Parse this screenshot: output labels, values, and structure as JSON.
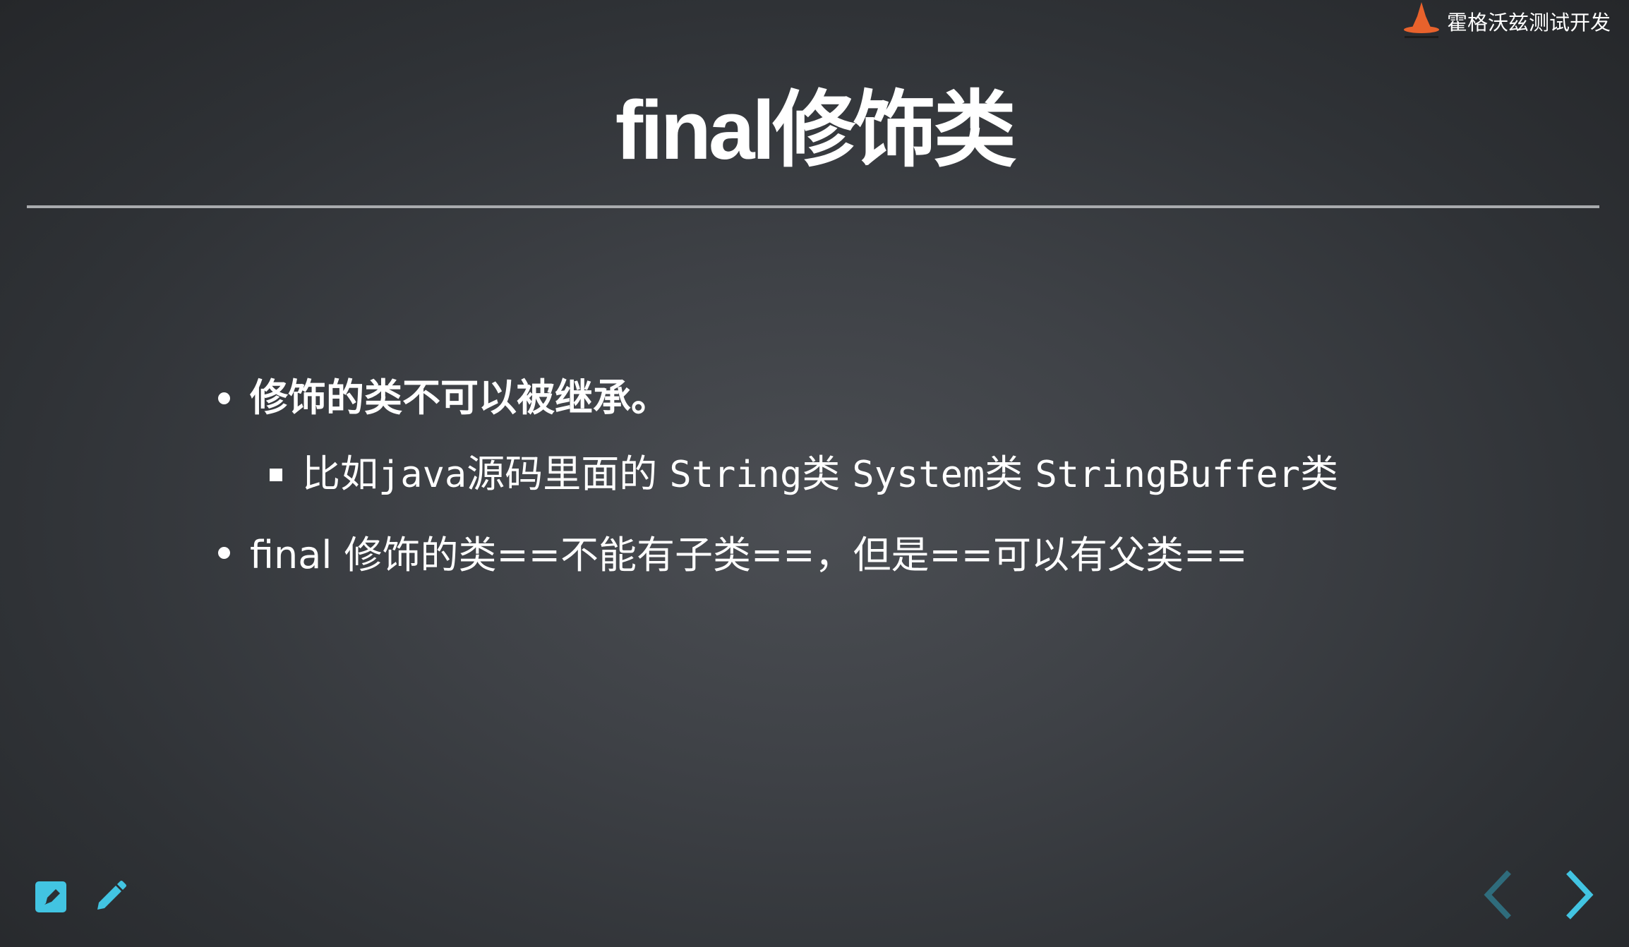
{
  "brand": {
    "name": "霍格沃兹测试开发",
    "logo_icon": "wizard-hat-icon",
    "logo_color": "#e8622c"
  },
  "slide": {
    "title": "final修饰类",
    "bullets": [
      {
        "text": "修饰的类不可以被继承。"
      },
      {
        "parts": [
          {
            "text": "比如",
            "mono": false
          },
          {
            "text": "java",
            "mono": true
          },
          {
            "text": "源码里面的 ",
            "mono": false
          },
          {
            "text": "String",
            "mono": true
          },
          {
            "text": "类 ",
            "mono": false
          },
          {
            "text": "System",
            "mono": true
          },
          {
            "text": "类 ",
            "mono": false
          },
          {
            "text": "StringBuffer",
            "mono": true
          },
          {
            "text": "类",
            "mono": false
          }
        ]
      },
      {
        "text": "final 修饰的类==不能有子类==，但是==可以有父类=="
      }
    ]
  },
  "toolbar": {
    "edit_icon": "edit-square-icon",
    "pen_icon": "pencil-icon",
    "accent": "#42c4e2"
  },
  "navigation": {
    "prev_icon": "chevron-left-icon",
    "next_icon": "chevron-right-icon",
    "prev_color": "#2f6c7c",
    "next_color": "#42c4e2"
  }
}
